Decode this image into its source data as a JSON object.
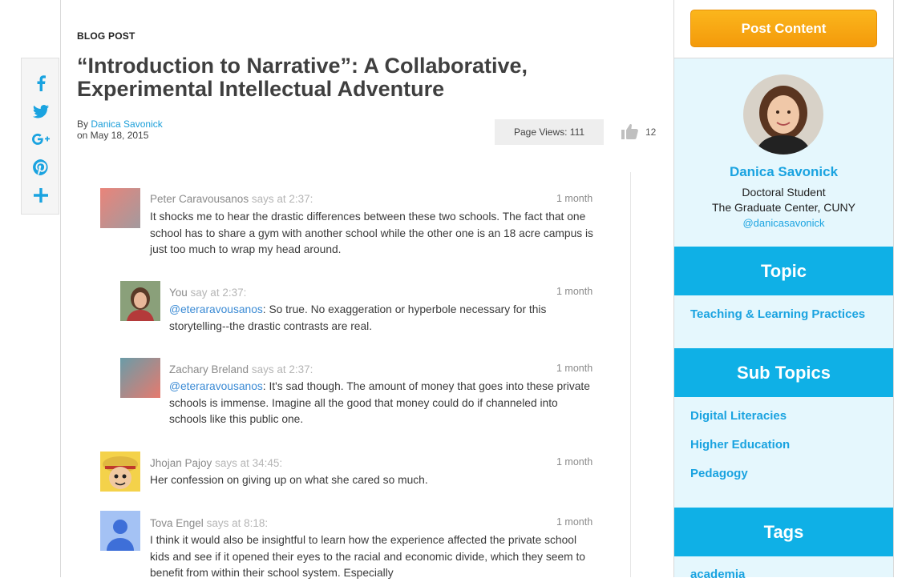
{
  "share": {
    "icons": [
      "facebook-icon",
      "twitter-icon",
      "google-plus-icon",
      "pinterest-icon",
      "plus-icon"
    ],
    "accent": "#1aa3e0"
  },
  "post": {
    "type_label": "BLOG POST",
    "title": "“Introduction to Narrative”: A Collaborative, Experimental Intellectual Adventure",
    "by_prefix": "By",
    "author": "Danica Savonick",
    "date": "on May 18, 2015",
    "page_views": "Page Views: 111",
    "likes": "12"
  },
  "comments": [
    {
      "name": "Peter Caravousanos",
      "says": "says at 2:37:",
      "time": "1 month",
      "mention": "",
      "text": "It shocks me to hear the drastic differences between these two schools. The fact that one school has to share a gym with another school while the other one is an 18 acre campus is just too much to wrap my head around."
    },
    {
      "name": "You",
      "says": "say at 2:37:",
      "time": "1 month",
      "mention": "@eteraravousanos",
      "text": ": So true. No exaggeration or hyperbole necessary for this storytelling--the drastic contrasts are real."
    },
    {
      "name": "Zachary Breland",
      "says": "says at 2:37:",
      "time": "1 month",
      "mention": "@eteraravousanos",
      "text": ": It's sad though. The amount of money that goes into these private schools is immense. Imagine all the good that money could do if channeled into schools like this public one."
    },
    {
      "name": "Jhojan Pajoy",
      "says": "says at 34:45:",
      "time": "1 month",
      "mention": "",
      "text": "Her confession on giving up on what she cared so much."
    },
    {
      "name": "Tova Engel",
      "says": "says at 8:18:",
      "time": "1 month",
      "mention": "",
      "text": "I think it would also be insightful to learn how the experience affected the private school kids and see if it opened their eyes to the racial and economic divide, which they seem to benefit from within their school system. Especially"
    }
  ],
  "sidebar": {
    "post_button": "Post Content",
    "profile": {
      "name": "Danica Savonick",
      "role": "Doctoral Student",
      "institution": "The Graduate Center, CUNY",
      "handle": "@danicasavonick"
    },
    "topic_heading": "Topic",
    "topics": [
      "Teaching & Learning Practices"
    ],
    "subtopics_heading": "Sub Topics",
    "subtopics": [
      "Digital Literacies",
      "Higher Education",
      "Pedagogy"
    ],
    "tags_heading": "Tags",
    "tags": [
      "academia"
    ]
  },
  "colors": {
    "accent_blue": "#1aa3e0",
    "section_header": "#0fb0e6",
    "sidebar_bg": "#e5f7fd",
    "button_orange": "#f7a712"
  }
}
